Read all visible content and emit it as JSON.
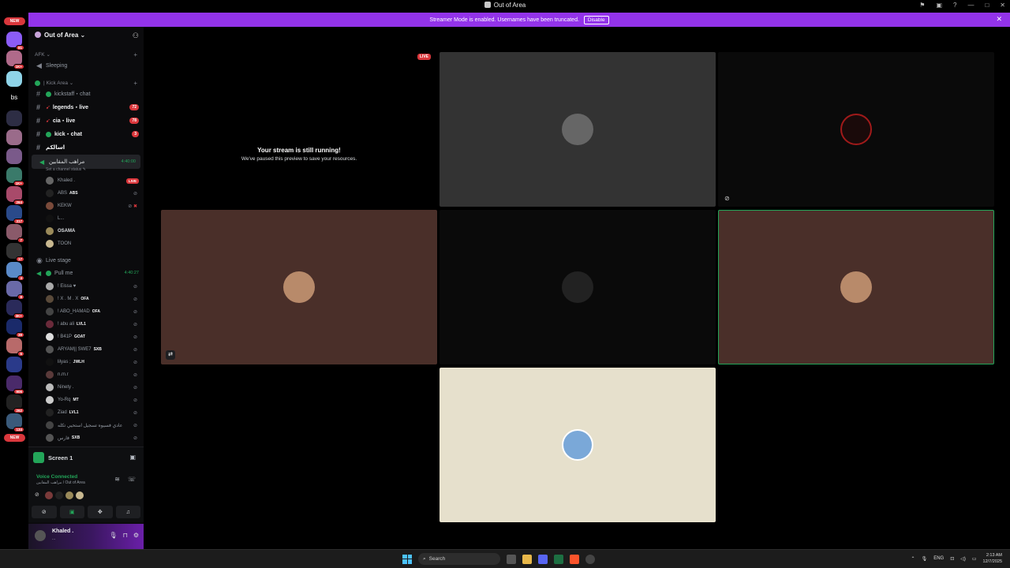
{
  "window": {
    "title": "Out of Area"
  },
  "banner": {
    "text": "Streamer Mode is enabled. Usernames have been truncated.",
    "button": "Disable"
  },
  "rail": {
    "new_top": "NEW",
    "new_bottom": "NEW",
    "bs": "bs",
    "badges": [
      "81",
      "1K+",
      "1K+",
      "264",
      "317",
      "7",
      "17",
      "4",
      "8",
      "3K+",
      "39",
      "6",
      "906",
      "262",
      "134"
    ]
  },
  "server": {
    "name": "Out of Area"
  },
  "sidebar": {
    "afk_category": "AFK",
    "sleeping": "Sleeping",
    "kick_category": "| Kick Area",
    "channels": [
      {
        "name": "kickstaff・chat",
        "mention": ""
      },
      {
        "name": "legends・live",
        "mention": "72"
      },
      {
        "name": "cia・live",
        "mention": "78"
      },
      {
        "name": "kick・chat",
        "mention": "3"
      },
      {
        "name": "اسالكم",
        "mention": ""
      }
    ],
    "voice_channel": {
      "name": "مراهب المقابين",
      "timer": "4:40:00",
      "status": "Set a channel status"
    },
    "voice_members": [
      {
        "name": "Khaled .",
        "tag": "",
        "live": "LIVE"
      },
      {
        "name": "ABS",
        "tag": "ABS",
        "live": ""
      },
      {
        "name": "KEKW",
        "tag": "",
        "live": ""
      },
      {
        "name": "L...",
        "tag": "",
        "live": ""
      },
      {
        "name": "OSAMA",
        "tag": "",
        "live": ""
      },
      {
        "name": "TOON",
        "tag": "",
        "live": ""
      }
    ],
    "live_stage": "Live stage",
    "pull_me": {
      "name": "Pull me",
      "timer": "4:40:27"
    },
    "pull_members": [
      {
        "name": "! Eissa",
        "tag": ""
      },
      {
        "name": "! X . M . X",
        "tag": "OFA"
      },
      {
        "name": "! ABO_HAMAD",
        "tag": "OFA"
      },
      {
        "name": "! abu ali",
        "tag": "LVL1"
      },
      {
        "name": "! B41P",
        "tag": "GOAT"
      },
      {
        "name": "ARYAM|| SWE7",
        "tag": "SXB"
      },
      {
        "name": "lilyas ;",
        "tag": "JWLH"
      },
      {
        "name": "n.m.r",
        "tag": ""
      },
      {
        "name": "Ninety .",
        "tag": ""
      },
      {
        "name": "Yo-Rq",
        "tag": "MT"
      },
      {
        "name": "Ziad",
        "tag": "LVL1"
      },
      {
        "name": "عادي فسيوه تسجيل استحيي تكله",
        "tag": ""
      },
      {
        "name": "فارس",
        "tag": "SXB"
      }
    ]
  },
  "voice_panel": {
    "screen": "Screen 1",
    "connected": "Voice Connected",
    "location": "مراهب المقابين / Out of Area"
  },
  "user": {
    "name": "Khaled .",
    "status": "..."
  },
  "stage": {
    "paused_title": "Your stream is still running!",
    "paused_sub": "We've paused this preview to save your resources.",
    "live": "LIVE"
  },
  "taskbar": {
    "search": "Search",
    "lang": "ENG",
    "time": "2:13 AM",
    "date": "12/7/2025"
  }
}
